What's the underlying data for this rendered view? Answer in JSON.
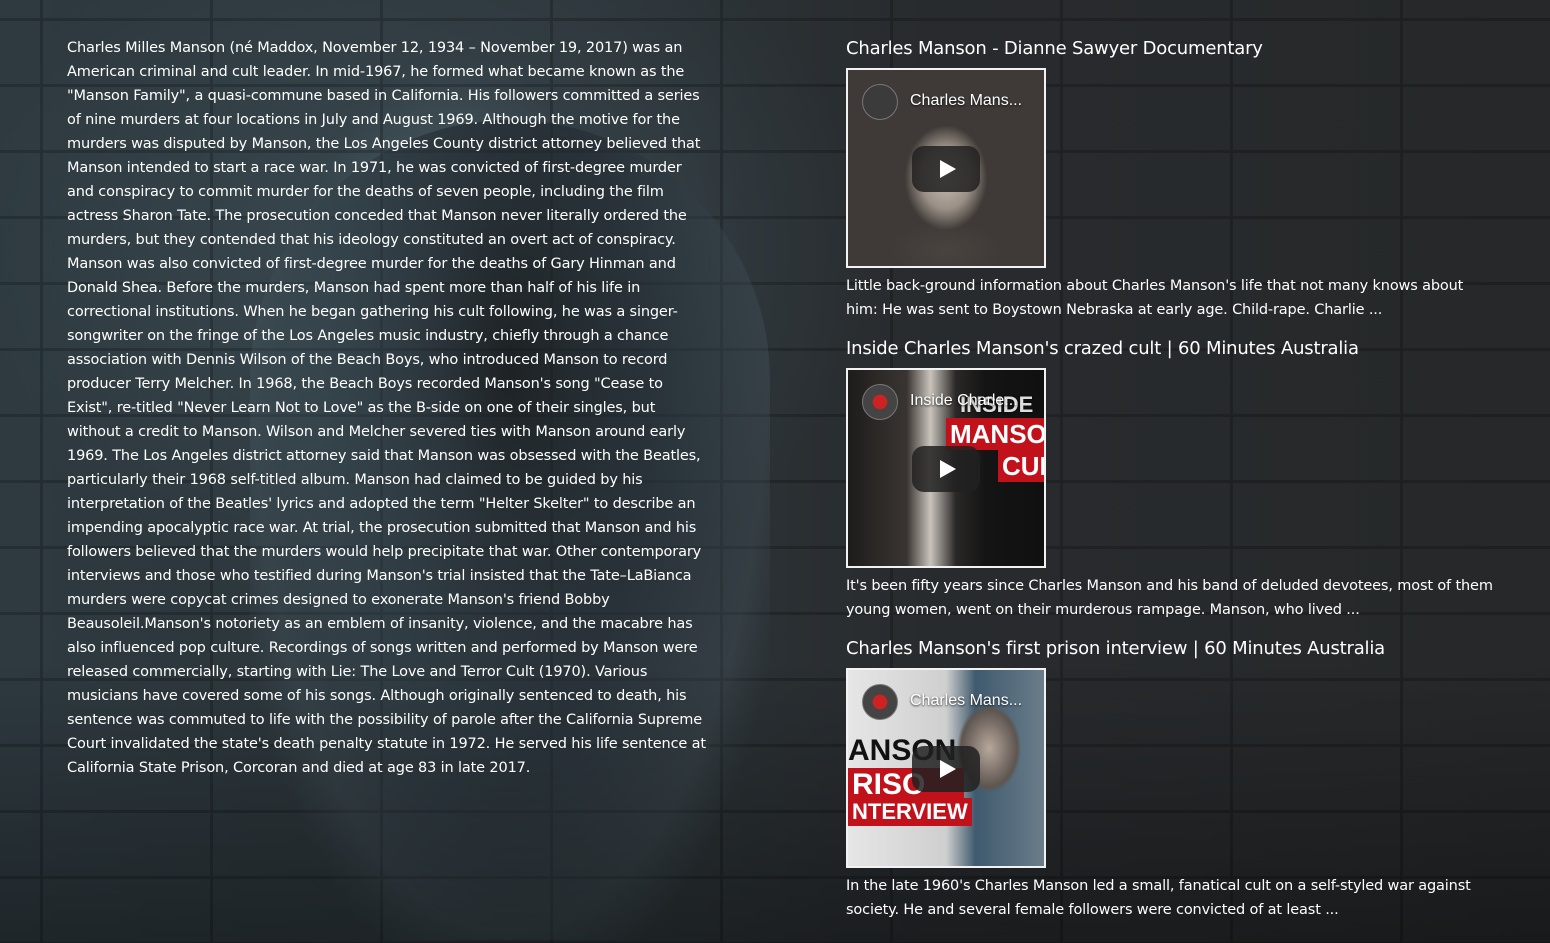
{
  "article": {
    "body": "Charles Milles Manson (né Maddox, November 12, 1934 – November 19, 2017) was an American criminal and cult leader. In mid-1967, he formed what became known as the \"Manson Family\", a quasi-commune based in California. His followers committed a series of nine murders at four locations in July and August 1969. Although the motive for the murders was disputed by Manson, the Los Angeles County district attorney believed that Manson intended to start a race war. In 1971, he was convicted of first-degree murder and conspiracy to commit murder for the deaths of seven people, including the film actress Sharon Tate. The prosecution conceded that Manson never literally ordered the murders, but they contended that his ideology constituted an overt act of conspiracy. Manson was also convicted of first-degree murder for the deaths of Gary Hinman and Donald Shea. Before the murders, Manson had spent more than half of his life in correctional institutions. When he began gathering his cult following, he was a singer-songwriter on the fringe of the Los Angeles music industry, chiefly through a chance association with Dennis Wilson of the Beach Boys, who introduced Manson to record producer Terry Melcher. In 1968, the Beach Boys recorded Manson's song \"Cease to Exist\", re-titled \"Never Learn Not to Love\" as the B-side on one of their singles, but without a credit to Manson. Wilson and Melcher severed ties with Manson around early 1969. The Los Angeles district attorney said that Manson was obsessed with the Beatles, particularly their 1968 self-titled album. Manson had claimed to be guided by his interpretation of the Beatles' lyrics and adopted the term \"Helter Skelter\" to describe an impending apocalyptic race war. At trial, the prosecution submitted that Manson and his followers believed that the murders would help precipitate that war. Other contemporary interviews and those who testified during Manson's trial insisted that the Tate–LaBianca murders were copycat crimes designed to exonerate Manson's friend Bobby Beausoleil.Manson's notoriety as an emblem of insanity, violence, and the macabre has also influenced pop culture. Recordings of songs written and performed by Manson were released commercially, starting with Lie: The Love and Terror Cult (1970). Various musicians have covered some of his songs. Although originally sentenced to death, his sentence was commuted to life with the possibility of parole after the California Supreme Court invalidated the state's death penalty statute in 1972. He served his life sentence at California State Prison, Corcoran and died at age 83 in late 2017."
  },
  "videos": [
    {
      "title": "Charles Manson - Dianne Sawyer Documentary",
      "thumb_label": "Charles Mans...",
      "description": "Little back-ground information about Charles Manson's life that not many knows about him: He was sent to Boystown Nebraska at early age. Child-rape. Charlie ..."
    },
    {
      "title": "Inside Charles Manson's crazed cult | 60 Minutes Australia",
      "thumb_label": "Inside Charle...",
      "overlay_lines": [
        "INSIDE",
        "MANSO",
        "CUI"
      ],
      "description": "It's been fifty years since Charles Manson and his band of deluded devotees, most of them young women, went on their murderous rampage. Manson, who lived ..."
    },
    {
      "title": "Charles Manson's first prison interview | 60 Minutes Australia",
      "thumb_label": "Charles Mans...",
      "overlay_lines": [
        "ANSON",
        "RISO",
        "NTERVIEW"
      ],
      "description": "In the late 1960's Charles Manson led a small, fanatical cult on a self-styled war against society. He and several female followers were convicted of at least ..."
    }
  ],
  "icons": {
    "play": "play-icon",
    "channel": "channel-avatar-icon"
  }
}
